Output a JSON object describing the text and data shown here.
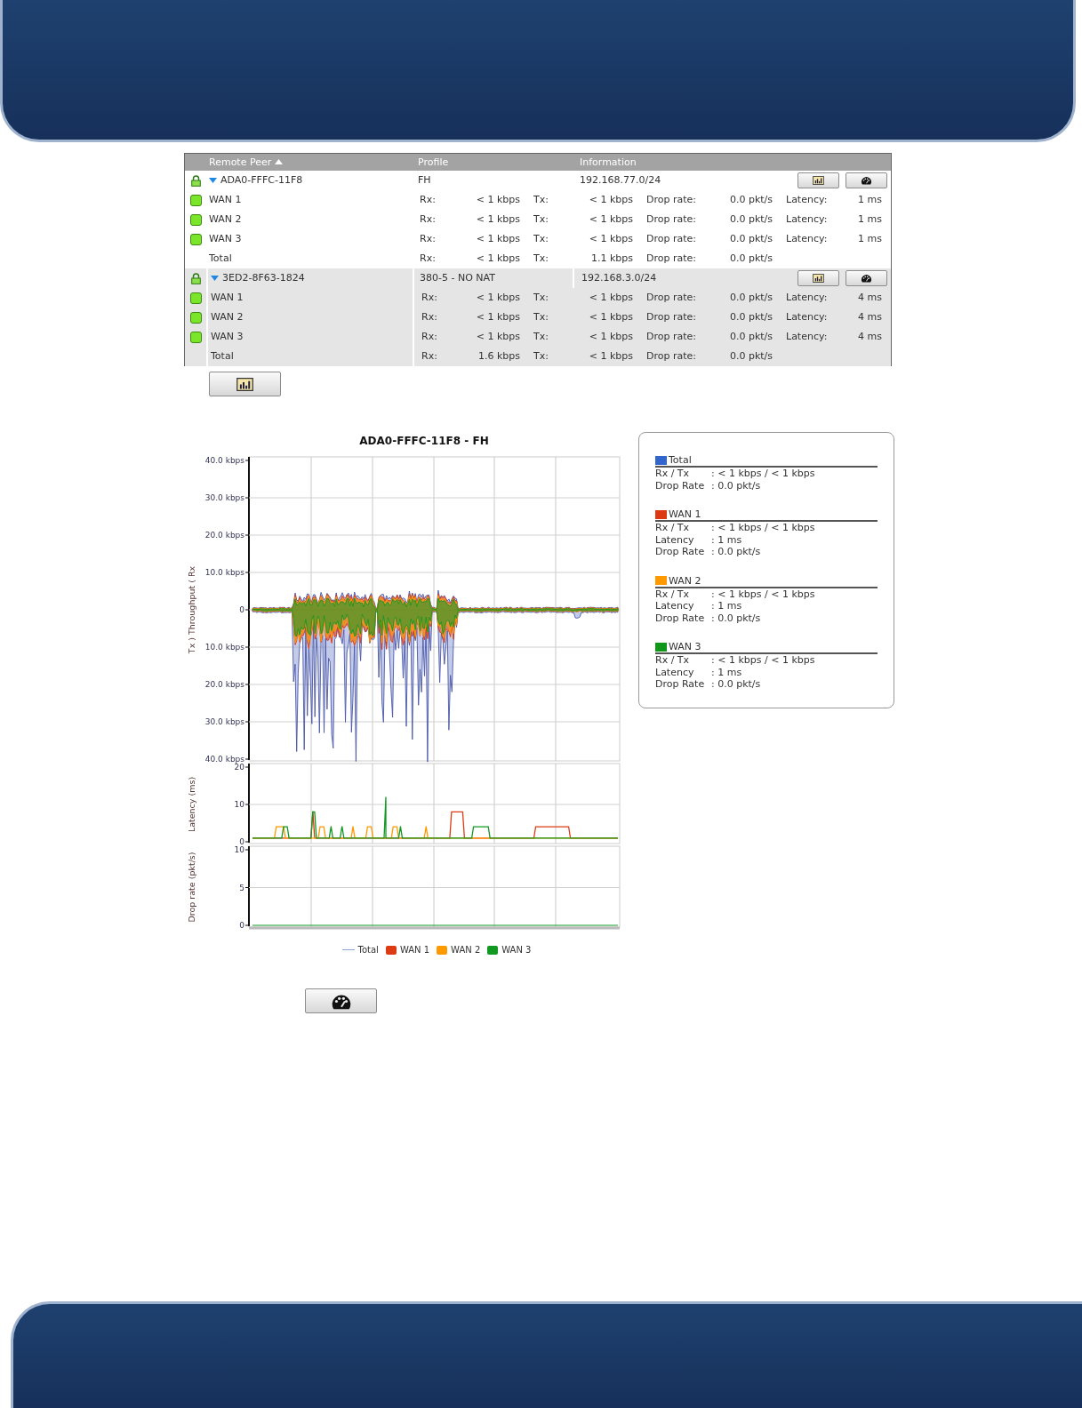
{
  "table": {
    "columns": [
      {
        "label": "Remote Peer",
        "sorted": true
      },
      {
        "label": "Profile",
        "sorted": false
      },
      {
        "label": "Information",
        "sorted": false
      }
    ],
    "peers": [
      {
        "name": "ADA0-FFFC-11F8",
        "expanded": true,
        "profile": "FH",
        "network": "192.168.77.0/24",
        "links": [
          {
            "kind": "wan",
            "name": "WAN 1",
            "rx_label": "Rx:",
            "rx": "< 1 kbps",
            "tx_label": "Tx:",
            "tx": "< 1 kbps",
            "drop_label": "Drop rate:",
            "drop": "0.0 pkt/s",
            "latency_label": "Latency:",
            "latency": "1 ms"
          },
          {
            "kind": "wan",
            "name": "WAN 2",
            "rx_label": "Rx:",
            "rx": "< 1 kbps",
            "tx_label": "Tx:",
            "tx": "< 1 kbps",
            "drop_label": "Drop rate:",
            "drop": "0.0 pkt/s",
            "latency_label": "Latency:",
            "latency": "1 ms"
          },
          {
            "kind": "wan",
            "name": "WAN 3",
            "rx_label": "Rx:",
            "rx": "< 1 kbps",
            "tx_label": "Tx:",
            "tx": "< 1 kbps",
            "drop_label": "Drop rate:",
            "drop": "0.0 pkt/s",
            "latency_label": "Latency:",
            "latency": "1 ms"
          },
          {
            "kind": "total",
            "name": "Total",
            "rx_label": "Rx:",
            "rx": "< 1 kbps",
            "tx_label": "Tx:",
            "tx": "1.1 kbps",
            "drop_label": "Drop rate:",
            "drop": "0.0 pkt/s"
          }
        ]
      },
      {
        "name": "3ED2-8F63-1824",
        "expanded": true,
        "profile": "380-5 - NO NAT",
        "network": "192.168.3.0/24",
        "links": [
          {
            "kind": "wan",
            "name": "WAN 1",
            "rx_label": "Rx:",
            "rx": "< 1 kbps",
            "tx_label": "Tx:",
            "tx": "< 1 kbps",
            "drop_label": "Drop rate:",
            "drop": "0.0 pkt/s",
            "latency_label": "Latency:",
            "latency": "4 ms"
          },
          {
            "kind": "wan",
            "name": "WAN 2",
            "rx_label": "Rx:",
            "rx": "< 1 kbps",
            "tx_label": "Tx:",
            "tx": "< 1 kbps",
            "drop_label": "Drop rate:",
            "drop": "0.0 pkt/s",
            "latency_label": "Latency:",
            "latency": "4 ms"
          },
          {
            "kind": "wan",
            "name": "WAN 3",
            "rx_label": "Rx:",
            "rx": "< 1 kbps",
            "tx_label": "Tx:",
            "tx": "< 1 kbps",
            "drop_label": "Drop rate:",
            "drop": "0.0 pkt/s",
            "latency_label": "Latency:",
            "latency": "4 ms"
          },
          {
            "kind": "total",
            "name": "Total",
            "rx_label": "Rx:",
            "rx": "1.6 kbps",
            "tx_label": "Tx:",
            "tx": "< 1 kbps",
            "drop_label": "Drop rate:",
            "drop": "0.0 pkt/s"
          }
        ]
      }
    ]
  },
  "graph": {
    "title": "ADA0-FFFC-11F8 - FH",
    "panels": [
      {
        "kind": "throughput",
        "ylabel": "Tx ) Throughput ( Rx",
        "yticks": [
          "40.0 kbps",
          "30.0 kbps",
          "20.0 kbps",
          "10.0 kbps",
          "0",
          "10.0 kbps",
          "20.0 kbps",
          "30.0 kbps",
          "40.0 kbps"
        ]
      },
      {
        "kind": "latency",
        "ylabel": "Latency (ms)",
        "yticks": [
          "20",
          "10",
          "0"
        ]
      },
      {
        "kind": "drop",
        "ylabel": "Drop rate (pkt/s)",
        "yticks": [
          "10",
          "5",
          "0"
        ]
      }
    ],
    "legend": [
      {
        "kind": "line",
        "name": "Total",
        "color": "#8fa3d9"
      },
      {
        "kind": "box",
        "name": "WAN 1",
        "color": "#dd3b14"
      },
      {
        "kind": "box",
        "name": "WAN 2",
        "color": "#ff9900"
      },
      {
        "kind": "box",
        "name": "WAN 3",
        "color": "#119922"
      }
    ]
  },
  "summary": [
    {
      "name": "Total",
      "color": "#3366cc",
      "rows": [
        {
          "label": "Rx / Tx",
          "value": ": < 1 kbps / < 1 kbps"
        },
        {
          "label": "Drop Rate",
          "value": ": 0.0 pkt/s"
        }
      ]
    },
    {
      "name": "WAN 1",
      "color": "#dc3912",
      "rows": [
        {
          "label": "Rx / Tx",
          "value": ": < 1 kbps / < 1 kbps"
        },
        {
          "label": "Latency",
          "value": ": 1 ms"
        },
        {
          "label": "Drop Rate",
          "value": ": 0.0 pkt/s"
        }
      ]
    },
    {
      "name": "WAN 2",
      "color": "#ff9900",
      "rows": [
        {
          "label": "Rx / Tx",
          "value": ": < 1 kbps / < 1 kbps"
        },
        {
          "label": "Latency",
          "value": ": 1 ms"
        },
        {
          "label": "Drop Rate",
          "value": ": 0.0 pkt/s"
        }
      ]
    },
    {
      "name": "WAN 3",
      "color": "#109618",
      "rows": [
        {
          "label": "Rx / Tx",
          "value": ": < 1 kbps / < 1 kbps"
        },
        {
          "label": "Latency",
          "value": ": 1 ms"
        },
        {
          "label": "Drop Rate",
          "value": ": 0.0 pkt/s"
        }
      ]
    }
  ]
}
